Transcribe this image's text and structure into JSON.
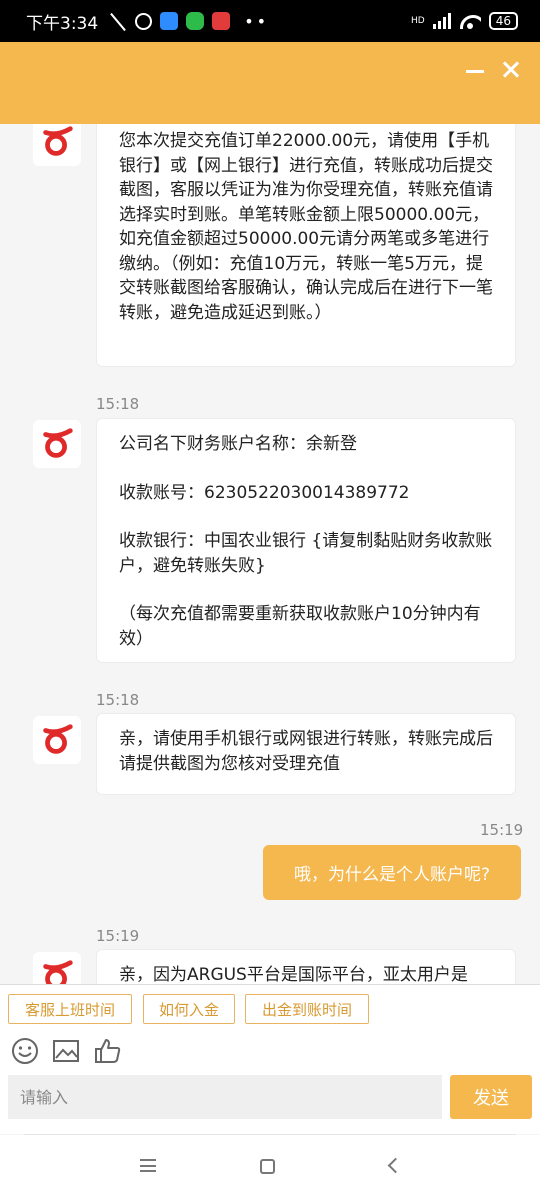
{
  "status_bar": {
    "time": "下午3:34",
    "battery": "46",
    "network": "HD"
  },
  "header": {
    "minimize_icon": "minimize-icon",
    "close_icon": "close-icon",
    "color": "#f5b84f"
  },
  "messages": [
    {
      "sender": "agent",
      "text": "您本次提交充值订单22000.00元，请使用【手机银行】或【网上银行】进行充值，转账成功后提交截图，客服以凭证为准为你受理充值，转账充值请选择实时到账。单笔转账金额上限50000.00元，如充值金额超过50000.00元请分两笔或多笔进行缴纳。（例如：充值10万元，转账一笔5万元，提交转账截图给客服确认，确认完成后在进行下一笔转账，避免造成延迟到账。）"
    },
    {
      "time": "15:18",
      "sender": "agent",
      "paragraphs": [
        "公司名下财务账户名称：余新登",
        "收款账号：6230522030014389772",
        "收款银行：中国农业银行 {请复制黏贴财务收款账户，避免转账失败}",
        "（每次充值都需要重新获取收款账户10分钟内有效）"
      ]
    },
    {
      "time": "15:18",
      "sender": "agent",
      "text": "亲，请使用手机银行或网银进行转账，转账完成后请提供截图为您核对受理充值"
    },
    {
      "time": "15:19",
      "sender": "user",
      "text": "哦，为什么是个人账户呢?"
    },
    {
      "time": "15:19",
      "sender": "agent",
      "text": "亲，因为ARGUS平台是国际平台，亚太用户是"
    }
  ],
  "quick_replies": [
    "客服上班时间",
    "如何入金",
    "出金到账时间"
  ],
  "toolbar": {
    "emoji_icon": "emoji-icon",
    "image_icon": "image-icon",
    "like_icon": "thumbs-up-icon"
  },
  "input": {
    "placeholder": "请输入",
    "send_label": "发送"
  },
  "colors": {
    "accent": "#f5b84f",
    "quick_border": "#e8b462",
    "logo_red": "#e02a2a"
  }
}
